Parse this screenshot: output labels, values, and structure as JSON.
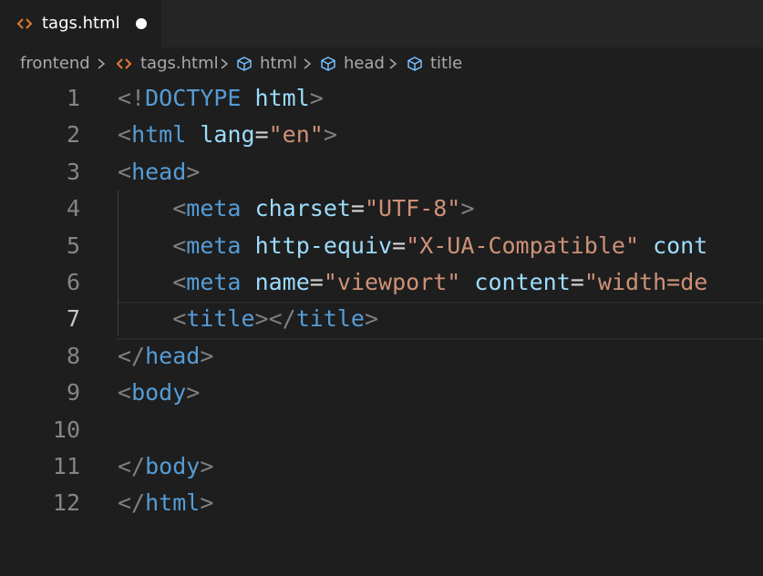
{
  "tab": {
    "label": "tags.html",
    "icon": "html-file-icon",
    "dirty": true
  },
  "breadcrumb": {
    "folder": "frontend",
    "file": "tags.html",
    "symbols": [
      "html",
      "head",
      "title"
    ]
  },
  "editor": {
    "active_line": 7,
    "line_numbers": [
      "1",
      "2",
      "3",
      "4",
      "5",
      "6",
      "7",
      "8",
      "9",
      "10",
      "11",
      "12"
    ],
    "lines": [
      [
        [
          "p",
          "<!"
        ],
        [
          "t",
          "DOCTYPE"
        ],
        [
          "o",
          " "
        ],
        [
          "a",
          "html"
        ],
        [
          "p",
          ">"
        ]
      ],
      [
        [
          "p",
          "<"
        ],
        [
          "t",
          "html"
        ],
        [
          "o",
          " "
        ],
        [
          "a",
          "lang"
        ],
        [
          "o",
          "="
        ],
        [
          "s",
          "\"en\""
        ],
        [
          "p",
          ">"
        ]
      ],
      [
        [
          "p",
          "<"
        ],
        [
          "t",
          "head"
        ],
        [
          "p",
          ">"
        ]
      ],
      [
        [
          "o",
          "    "
        ],
        [
          "p",
          "<"
        ],
        [
          "t",
          "meta"
        ],
        [
          "o",
          " "
        ],
        [
          "a",
          "charset"
        ],
        [
          "o",
          "="
        ],
        [
          "s",
          "\"UTF-8\""
        ],
        [
          "p",
          ">"
        ]
      ],
      [
        [
          "o",
          "    "
        ],
        [
          "p",
          "<"
        ],
        [
          "t",
          "meta"
        ],
        [
          "o",
          " "
        ],
        [
          "a",
          "http-equiv"
        ],
        [
          "o",
          "="
        ],
        [
          "s",
          "\"X-UA-Compatible\""
        ],
        [
          "o",
          " "
        ],
        [
          "a",
          "cont"
        ]
      ],
      [
        [
          "o",
          "    "
        ],
        [
          "p",
          "<"
        ],
        [
          "t",
          "meta"
        ],
        [
          "o",
          " "
        ],
        [
          "a",
          "name"
        ],
        [
          "o",
          "="
        ],
        [
          "s",
          "\"viewport\""
        ],
        [
          "o",
          " "
        ],
        [
          "a",
          "content"
        ],
        [
          "o",
          "="
        ],
        [
          "s",
          "\"width=de"
        ]
      ],
      [
        [
          "o",
          "    "
        ],
        [
          "p",
          "<"
        ],
        [
          "t",
          "title"
        ],
        [
          "p",
          "></"
        ],
        [
          "t",
          "title"
        ],
        [
          "p",
          ">"
        ]
      ],
      [
        [
          "p",
          "</"
        ],
        [
          "t",
          "head"
        ],
        [
          "p",
          ">"
        ]
      ],
      [
        [
          "p",
          "<"
        ],
        [
          "t",
          "body"
        ],
        [
          "p",
          ">"
        ]
      ],
      [],
      [
        [
          "p",
          "</"
        ],
        [
          "t",
          "body"
        ],
        [
          "p",
          ">"
        ]
      ],
      [
        [
          "p",
          "</"
        ],
        [
          "t",
          "html"
        ],
        [
          "p",
          ">"
        ]
      ]
    ]
  },
  "colors": {
    "background": "#1e1e1e",
    "tag": "#569cd6",
    "attribute": "#9cdcfe",
    "string": "#ce9178",
    "punctuation": "#808080",
    "html_icon": "#e37933",
    "symbol_icon": "#75beff"
  }
}
